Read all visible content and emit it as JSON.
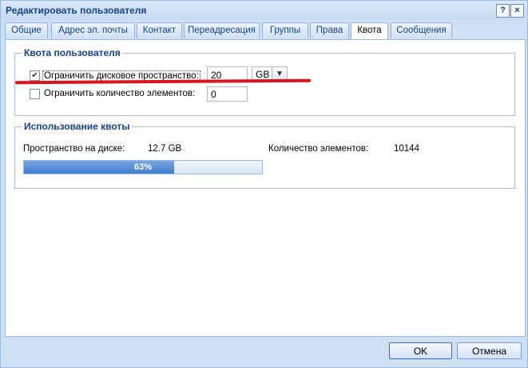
{
  "window": {
    "title": "Редактировать пользователя",
    "help_label": "?",
    "close_label": "×"
  },
  "tabs": [
    {
      "label": "Общие"
    },
    {
      "label": "Адрес эл. почты"
    },
    {
      "label": "Контакт"
    },
    {
      "label": "Переадресация"
    },
    {
      "label": "Группы"
    },
    {
      "label": "Права"
    },
    {
      "label": "Квота",
      "active": true
    },
    {
      "label": "Сообщения"
    }
  ],
  "quota": {
    "legend": "Квота пользователя",
    "disk_label": "Ограничить дисковое пространство:",
    "disk_checked": true,
    "disk_value": "20",
    "disk_unit": "GB",
    "items_label": "Ограничить количество элементов:",
    "items_checked": false,
    "items_value": "0"
  },
  "usage": {
    "legend": "Использование квоты",
    "disk_label": "Пространство на диске:",
    "disk_value": "12.7 GB",
    "items_label": "Количество элементов:",
    "items_value": "10144",
    "progress_text": "63%",
    "progress_fraction": 0.63
  },
  "buttons": {
    "ok": "OK",
    "cancel": "Отмена"
  },
  "colors": {
    "accent": "#15428b",
    "annotation": "#d9141f",
    "progress": "#3f7ccb"
  }
}
